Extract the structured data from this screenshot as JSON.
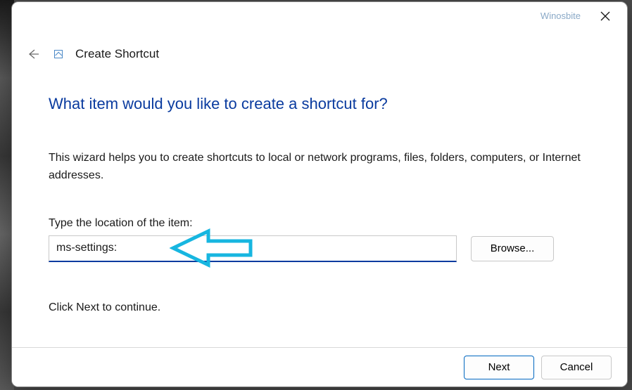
{
  "watermark": "Winosbite",
  "header": {
    "title": "Create Shortcut"
  },
  "question": "What item would you like to create a shortcut for?",
  "wizard_desc": "This wizard helps you to create shortcuts to local or network programs, files, folders, computers, or Internet addresses.",
  "field_label": "Type the location of the item:",
  "location_value": "ms-settings:",
  "browse_label": "Browse...",
  "continue_text": "Click Next to continue.",
  "footer": {
    "next_label": "Next",
    "cancel_label": "Cancel"
  },
  "annotation_color": "#17b6e0"
}
